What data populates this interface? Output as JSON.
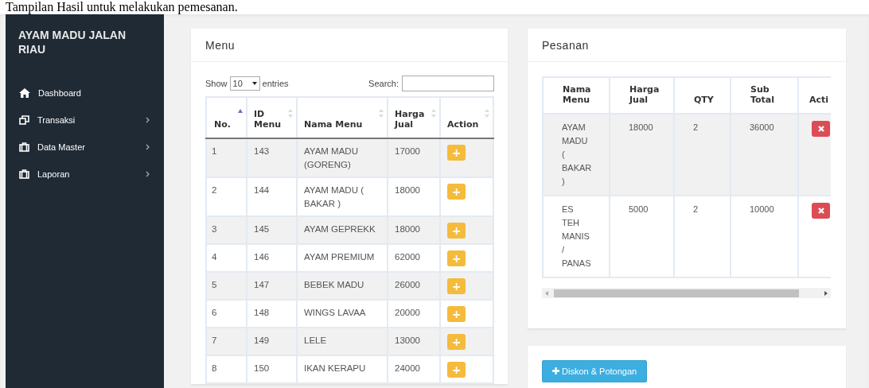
{
  "caption": "Tampilan Hasil untuk melakukan pemesanan.",
  "sidebar": {
    "brand": "AYAM MADU JALAN RIAU",
    "items": [
      {
        "kind": "home",
        "label": "Dashboard",
        "expandable": false
      },
      {
        "kind": "copy",
        "label": "Transaksi",
        "expandable": true
      },
      {
        "kind": "case",
        "label": "Data Master",
        "expandable": true
      },
      {
        "kind": "case",
        "label": "Laporan",
        "expandable": true
      }
    ]
  },
  "menu_panel": {
    "title": "Menu",
    "length_label_before": "Show",
    "length_value": "10",
    "length_label_after": "entries",
    "search_label": "Search:",
    "columns": [
      {
        "label": "No.",
        "sorted": true
      },
      {
        "label": "ID Menu",
        "sorted": false
      },
      {
        "label": "Nama Menu",
        "sorted": false
      },
      {
        "label": "Harga Jual",
        "sorted": false
      },
      {
        "label": "Action",
        "sorted": false
      }
    ],
    "rows": [
      [
        "1",
        "143",
        "AYAM MADU (GORENG)",
        "17000"
      ],
      [
        "2",
        "144",
        "AYAM MADU ( BAKAR )",
        "18000"
      ],
      [
        "3",
        "145",
        "AYAM GEPREKK",
        "18000"
      ],
      [
        "4",
        "146",
        "AYAM PREMIUM",
        "62000"
      ],
      [
        "5",
        "147",
        "BEBEK MADU",
        "26000"
      ],
      [
        "6",
        "148",
        "WINGS LAVAA",
        "20000"
      ],
      [
        "7",
        "149",
        "LELE",
        "13000"
      ],
      [
        "8",
        "150",
        "IKAN KERAPU",
        "24000"
      ]
    ],
    "add_button": "+"
  },
  "order_panel": {
    "title": "Pesanan",
    "columns": [
      "Nama Menu",
      "Harga Jual",
      "QTY",
      "Sub Total",
      "Acti"
    ],
    "rows": [
      [
        "AYAM MADU ( BAKAR )",
        "18000",
        "2",
        "36000"
      ],
      [
        "ES TEH MANIS / PANAS",
        "5000",
        "2",
        "10000"
      ]
    ]
  },
  "discount_button": "Diskon & Potongan"
}
